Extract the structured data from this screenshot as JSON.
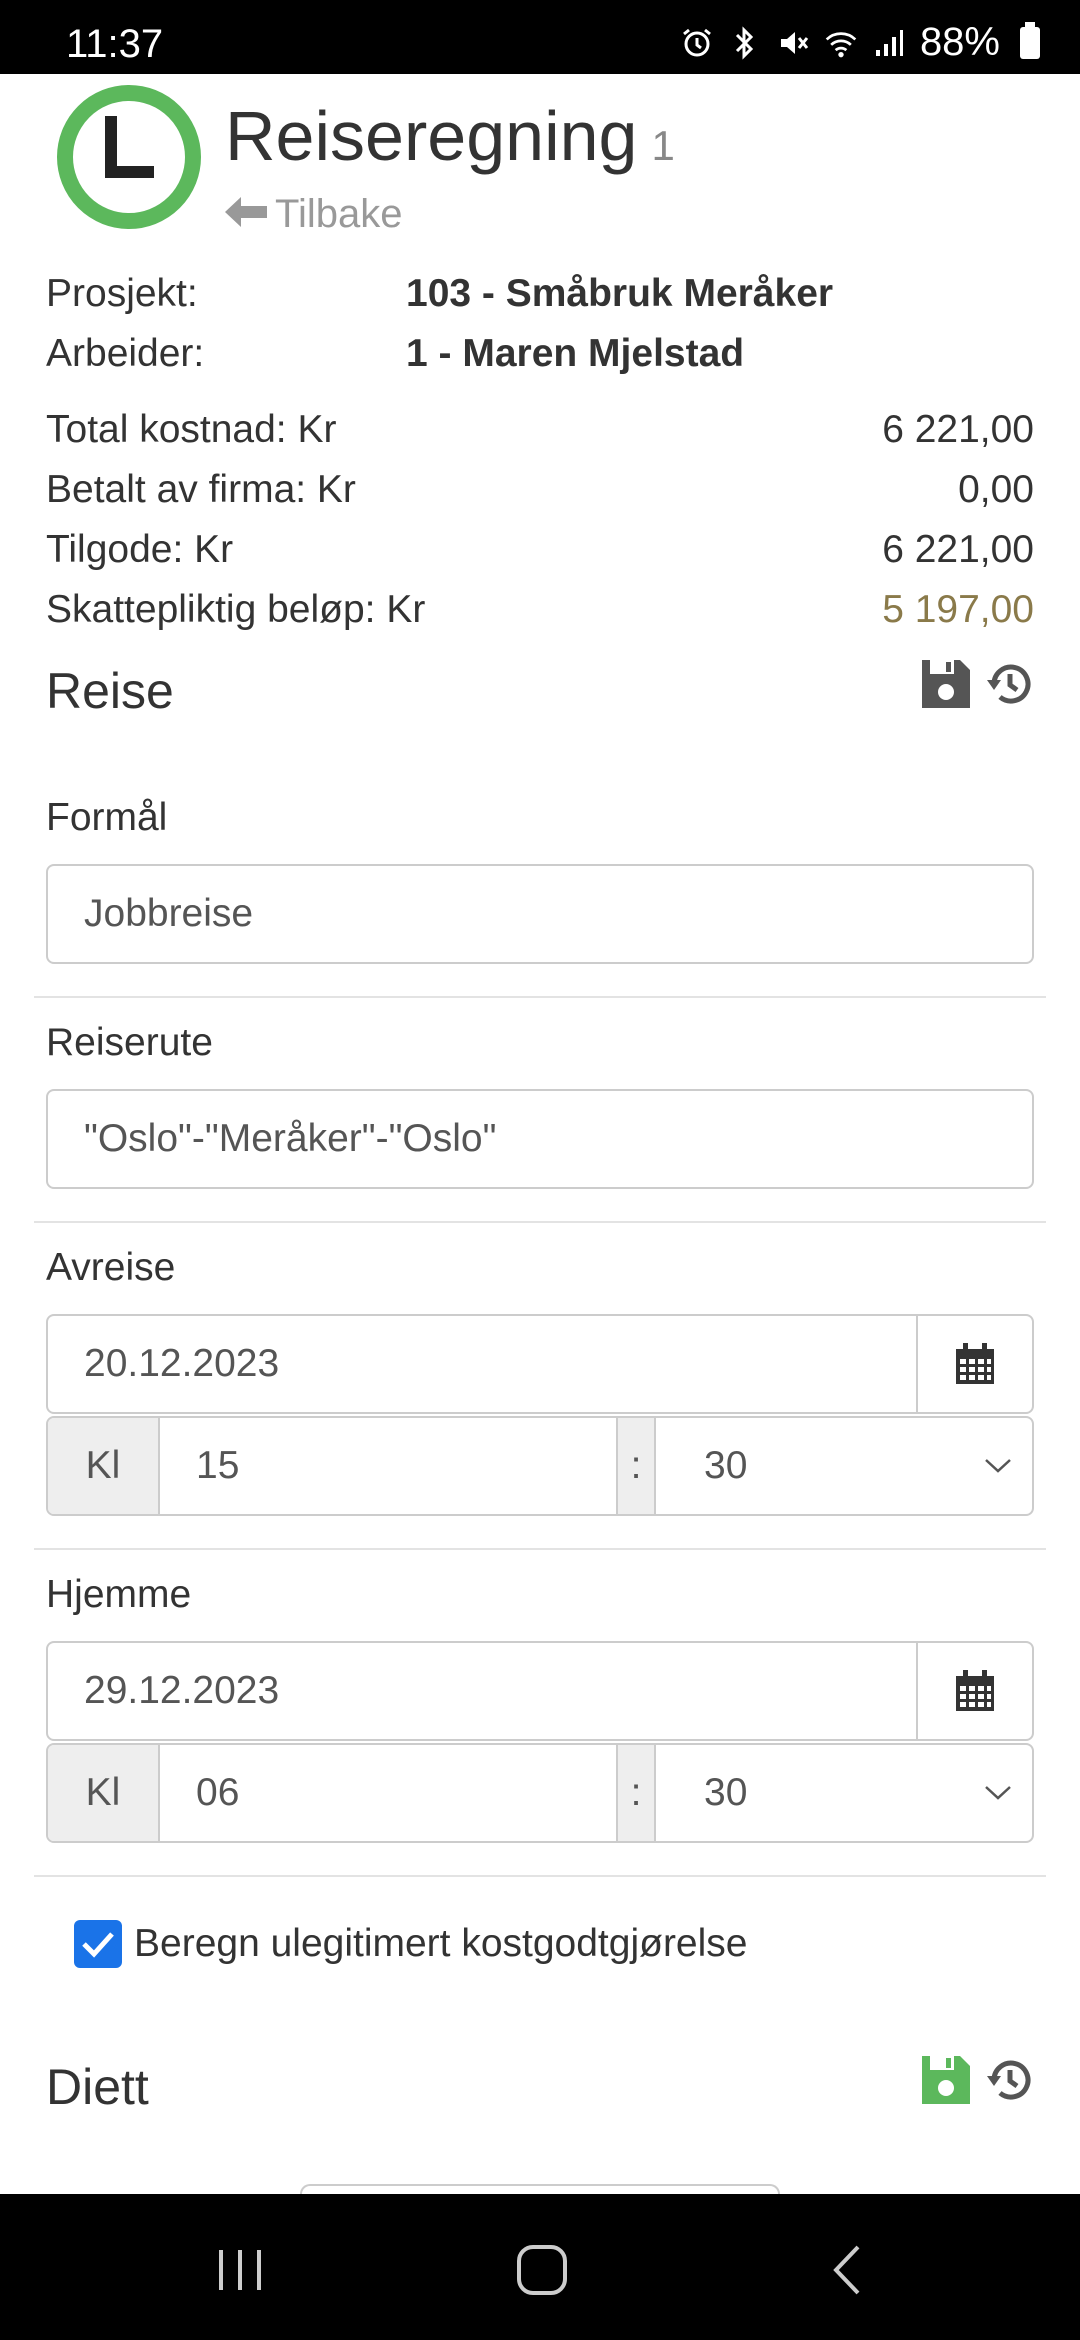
{
  "status_bar": {
    "time": "11:37",
    "battery": "88%"
  },
  "header": {
    "title": "Reiseregning",
    "count": "1",
    "back_label": "Tilbake"
  },
  "info": {
    "project_label": "Prosjekt:",
    "project_value": "103 - Småbruk Meråker",
    "worker_label": "Arbeider:",
    "worker_value": "1 - Maren Mjelstad"
  },
  "summary": {
    "total_label": "Total kostnad: Kr",
    "total_value": "6 221,00",
    "paid_label": "Betalt av firma: Kr",
    "paid_value": "0,00",
    "due_label": "Tilgode: Kr",
    "due_value": "6 221,00",
    "taxable_label": "Skattepliktig beløp: Kr",
    "taxable_value": "5 197,00"
  },
  "reise": {
    "title": "Reise",
    "purpose_label": "Formål",
    "purpose_value": "Jobbreise",
    "route_label": "Reiserute",
    "route_value": "\"Oslo\"-\"Meråker\"-\"Oslo\"",
    "departure_label": "Avreise",
    "departure_date": "20.12.2023",
    "departure_kl": "Kl",
    "departure_hour": "15",
    "departure_sep": ":",
    "departure_minute": "30",
    "home_label": "Hjemme",
    "home_date": "29.12.2023",
    "home_kl": "Kl",
    "home_hour": "06",
    "home_sep": ":",
    "home_minute": "30",
    "checkbox_label": "Beregn ulegitimert kostgodtgjørelse",
    "checkbox_checked": true
  },
  "diett": {
    "title": "Diett"
  },
  "colors": {
    "accent_green": "#5cb85c",
    "taxable_text": "#8a7a4a",
    "checkbox_blue": "#1a73e8",
    "icon_gray": "#555555"
  },
  "icons": [
    "alarm-icon",
    "bluetooth-icon",
    "mute-icon",
    "wifi-icon",
    "signal-icon",
    "battery-icon",
    "clock-logo-icon",
    "arrow-left-icon",
    "save-icon",
    "history-icon",
    "calendar-icon",
    "chevron-down-icon",
    "check-icon",
    "recents-icon",
    "home-icon",
    "back-nav-icon"
  ]
}
